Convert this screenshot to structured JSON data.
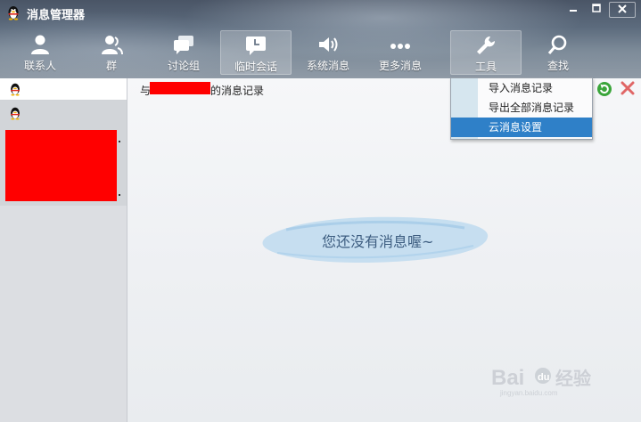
{
  "window": {
    "title": "消息管理器",
    "controls": [
      "minimize",
      "maximize",
      "close"
    ]
  },
  "toolbar": {
    "items": [
      {
        "label": "联系人",
        "icon": "person-icon"
      },
      {
        "label": "群",
        "icon": "group-icon"
      },
      {
        "label": "讨论组",
        "icon": "discussion-icon"
      },
      {
        "label": "临时会话",
        "icon": "temp-chat-icon",
        "active": true
      },
      {
        "label": "系统消息",
        "icon": "speaker-icon"
      },
      {
        "label": "更多消息",
        "icon": "more-icon"
      },
      {
        "label": "工具",
        "icon": "wrench-icon",
        "active": true
      },
      {
        "label": "查找",
        "icon": "search-icon"
      }
    ]
  },
  "main": {
    "record_prefix": "与",
    "record_suffix": "的消息记录",
    "empty_message": "您还没有消息喔~"
  },
  "tools_menu": {
    "items": [
      {
        "label": "导入消息记录"
      },
      {
        "label": "导出全部消息记录"
      },
      {
        "label": "云消息设置",
        "highlighted": true
      }
    ]
  },
  "watermark": {
    "brand": "Baidu",
    "subtitle": "经验",
    "url": "jingyan.baidu.com"
  },
  "colors": {
    "accent": "#2f80c8",
    "redaction": "#ff0000",
    "empty_text": "#3d5d80"
  }
}
